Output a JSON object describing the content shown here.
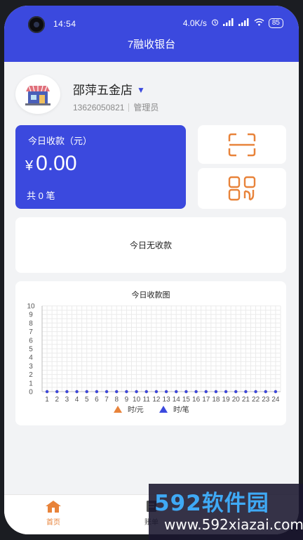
{
  "status_bar": {
    "time": "14:54",
    "network_speed": "4.0K/s",
    "battery": "85"
  },
  "app": {
    "title": "7融收银台"
  },
  "store": {
    "name": "邵萍五金店",
    "phone": "13626050821",
    "role": "管理员"
  },
  "today": {
    "label": "今日收款（元）",
    "currency": "¥",
    "amount": "0.00",
    "count_text": "共 0 笔"
  },
  "actions": {
    "scan_icon": "scan-icon",
    "qr_icon": "qr-code-icon",
    "accent": "#e8833a"
  },
  "empty_message": "今日无收款",
  "chart_data": {
    "type": "line",
    "title": "今日收款图",
    "x": [
      "1",
      "2",
      "3",
      "4",
      "5",
      "6",
      "7",
      "8",
      "9",
      "10",
      "11",
      "12",
      "13",
      "14",
      "15",
      "16",
      "17",
      "18",
      "19",
      "20",
      "21",
      "22",
      "23",
      "24"
    ],
    "ylim": [
      0,
      10
    ],
    "yticks": [
      0,
      1,
      2,
      3,
      4,
      5,
      6,
      7,
      8,
      9,
      10
    ],
    "grid": true,
    "legend_placement": "bottom",
    "series": [
      {
        "name": "时/元",
        "color": "#e8833a",
        "marker": "triangle",
        "values": [
          0,
          0,
          0,
          0,
          0,
          0,
          0,
          0,
          0,
          0,
          0,
          0,
          0,
          0,
          0,
          0,
          0,
          0,
          0,
          0,
          0,
          0,
          0,
          0
        ]
      },
      {
        "name": "时/笔",
        "color": "#3b49de",
        "marker": "triangle",
        "values": [
          0,
          0,
          0,
          0,
          0,
          0,
          0,
          0,
          0,
          0,
          0,
          0,
          0,
          0,
          0,
          0,
          0,
          0,
          0,
          0,
          0,
          0,
          0,
          0
        ]
      }
    ]
  },
  "tabs": [
    {
      "label": "首页",
      "icon": "home-icon",
      "active": true
    },
    {
      "label": "账单",
      "icon": "bill-icon",
      "active": false
    }
  ],
  "colors": {
    "primary": "#3b49de",
    "accent": "#e8833a"
  },
  "watermark": {
    "big": "592软件园",
    "small": "www.592xiazai.com"
  }
}
